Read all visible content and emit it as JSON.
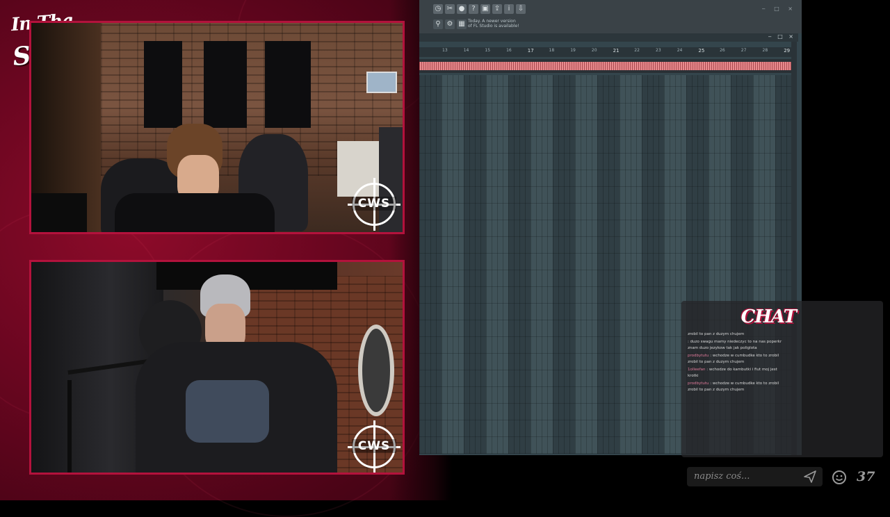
{
  "overlay": {
    "logo_line1": "In Tha",
    "logo_line2": "Studio!",
    "cam_badge": "CWS"
  },
  "fl_studio": {
    "toolbar_icons": [
      "clock-icon",
      "cut-icon",
      "mic-icon",
      "help-icon",
      "save-icon",
      "export-icon",
      "info-icon",
      "download-icon"
    ],
    "hint": "Today. A newer version of FL Studio is available!",
    "window_controls": "‒ □ ×",
    "ruler": [
      "13",
      "14",
      "15",
      "16",
      "17",
      "18",
      "19",
      "20",
      "21",
      "22",
      "23",
      "24",
      "25",
      "26",
      "27",
      "28",
      "29"
    ]
  },
  "chat": {
    "title": "CHAT",
    "messages": [
      {
        "user": "",
        "text": "zrobil to pan z duzym chujem"
      },
      {
        "user": "",
        "text": ": duzo swagu mamy niedeczyc to na nas poperkr znam duzo jezykow tak jak poliglota"
      },
      {
        "user": "prodbytutu",
        "text": ": wchodze w cumbudke kto to zrobil zrobil to pan z duzym chujem"
      },
      {
        "user": "1olleefan",
        "text": ": wchodze do kambutki i fiut moj jest krotki"
      },
      {
        "user": "prodbytutu",
        "text": ": wchodze w cumbudke kto to zrobil zrobil to pan z duzym chujem"
      }
    ],
    "input_placeholder": "napisz coś...",
    "viewer_count": "37"
  },
  "colors": {
    "brand_red": "#b3123c",
    "clip_color": "#e88b8e"
  }
}
